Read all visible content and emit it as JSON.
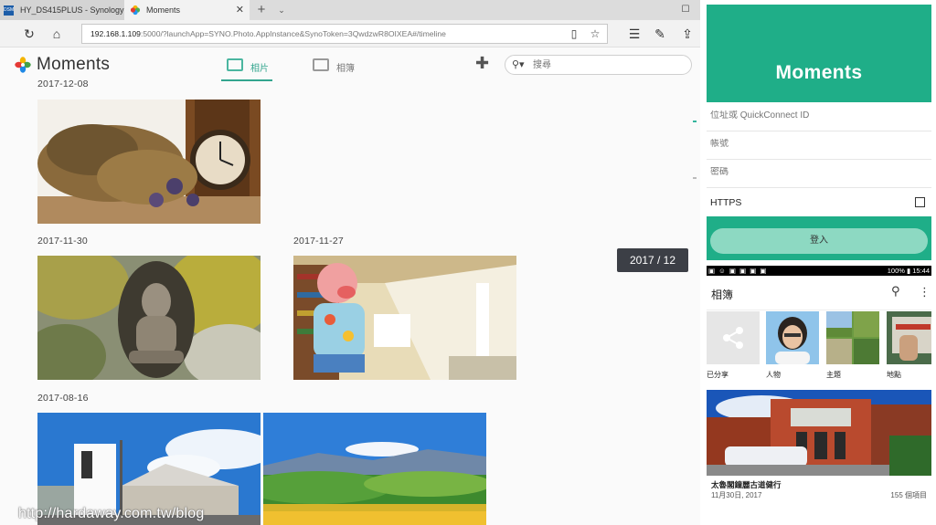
{
  "browser": {
    "tabs": [
      {
        "title": "HY_DS415PLUS - Synology I",
        "favicon": "DSM"
      },
      {
        "title": "Moments"
      }
    ],
    "url_host": "192.168.1.109",
    "url_rest": ":5000/?launchApp=SYNO.Photo.AppInstance&SynoToken=3QwdzwR8OIXEA#/timeline"
  },
  "app": {
    "title": "Moments",
    "tabs": [
      {
        "label": "相片"
      },
      {
        "label": "相簿"
      }
    ],
    "search_placeholder": "搜尋",
    "colors": {
      "accent": "#33a58e",
      "login_green": "#1fae88"
    }
  },
  "timeline": {
    "dates": [
      "2017-12-08",
      "2017-11-30",
      "2017-11-27",
      "2017-08-16"
    ],
    "date_bubble": "2017 / 12"
  },
  "watermark": "http://hardaway.com.tw/blog",
  "login": {
    "title": "Moments",
    "address_placeholder": "位址或 QuickConnect ID",
    "account_placeholder": "帳號",
    "password_placeholder": "密碼",
    "https_label": "HTTPS",
    "https_checked": false,
    "login_button": "登入"
  },
  "phone": {
    "status_right": "100% ▮ 15:44",
    "title": "相簿",
    "categories": [
      {
        "label": "已分享",
        "icon": "share-icon"
      },
      {
        "label": "人物"
      },
      {
        "label": "主題"
      },
      {
        "label": "地點"
      }
    ],
    "album": {
      "title": "太魯閣鐘麗古道健行",
      "date": "11月30日, 2017",
      "count": "155 個項目"
    }
  }
}
